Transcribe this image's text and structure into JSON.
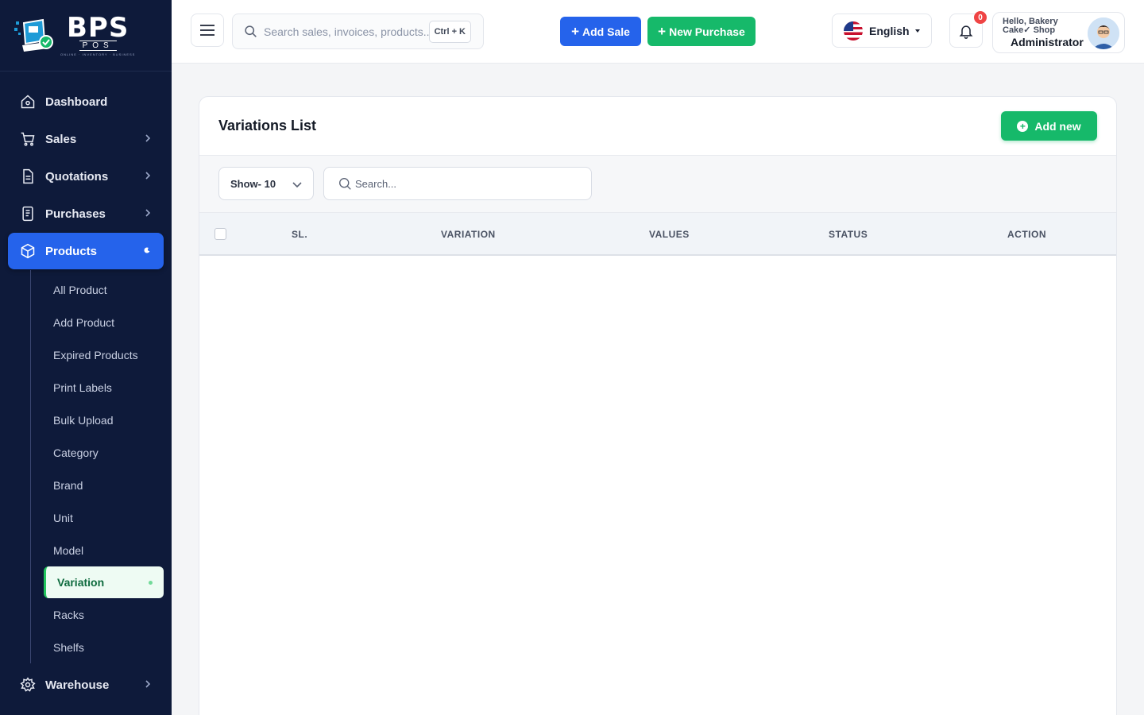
{
  "brand": {
    "logo_text": "BPS",
    "logo_sub": "POS",
    "logo_tag": "ONLINE · INVENTORY · BUSINESS"
  },
  "sidebar": {
    "items": [
      {
        "label": "Dashboard",
        "icon": "home-icon"
      },
      {
        "label": "Sales",
        "icon": "cart-icon"
      },
      {
        "label": "Quotations",
        "icon": "document-icon"
      },
      {
        "label": "Purchases",
        "icon": "receipt-icon"
      },
      {
        "label": "Products",
        "icon": "box-icon",
        "active": true
      },
      {
        "label": "Warehouse",
        "icon": "gear-icon"
      }
    ],
    "product_submenu": [
      "All Product",
      "Add Product",
      "Expired Products",
      "Print Labels",
      "Bulk Upload",
      "Category",
      "Brand",
      "Unit",
      "Model",
      "Variation",
      "Racks",
      "Shelfs"
    ],
    "active_submenu": "Variation"
  },
  "header": {
    "search_placeholder": "Search sales, invoices, products...",
    "shortcut": "Ctrl + K",
    "add_sale_label": "Add Sale",
    "new_purchase_label": "New Purchase",
    "language": "English",
    "notification_count": "0",
    "user_greeting": "Hello, Bakery Cake✓ Shop",
    "user_role": "Administrator"
  },
  "page": {
    "title": "Variations List",
    "add_new_label": "Add new",
    "show_value": "Show- 10",
    "search_placeholder": "Search...",
    "columns": [
      "SL.",
      "VARIATION",
      "VALUES",
      "STATUS",
      "ACTION"
    ],
    "rows": []
  },
  "colors": {
    "sidebar_bg": "#0e1a3a",
    "primary": "#2563eb",
    "success": "#16b96a"
  }
}
